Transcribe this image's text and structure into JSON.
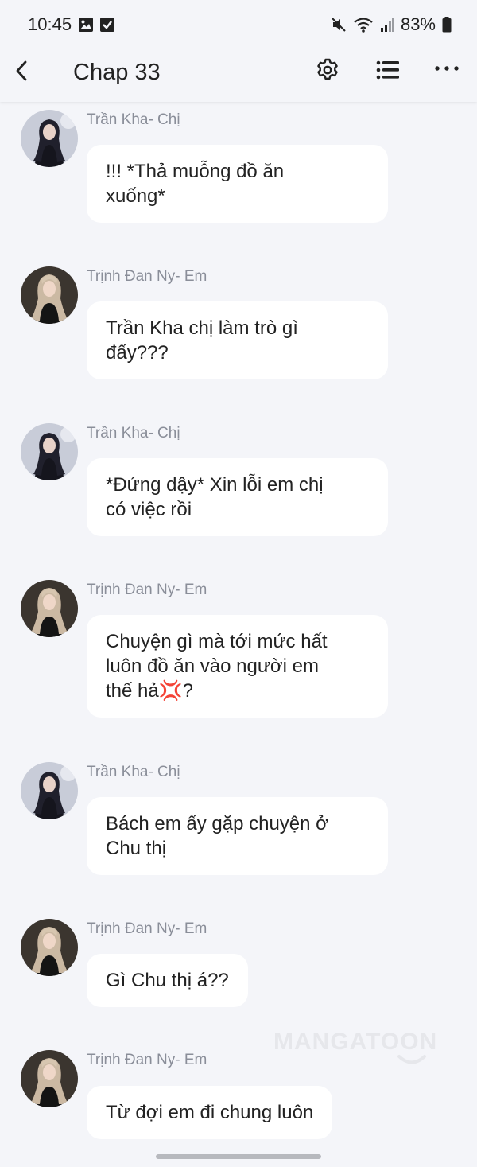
{
  "status_bar": {
    "time": "10:45",
    "battery": "83%",
    "icons": [
      "image-icon",
      "check-box-icon",
      "mute-icon",
      "wifi-icon",
      "signal-icon",
      "battery-icon"
    ]
  },
  "app_bar": {
    "title": "Chap 33",
    "icons": [
      "back-arrow-icon",
      "gear-icon",
      "list-icon",
      "more-icon"
    ]
  },
  "colors": {
    "background": "#f4f5f9",
    "bubble": "#ffffff",
    "sender_name": "#8a8e99",
    "text": "#222222"
  },
  "messages": [
    {
      "sender": "Trần Kha- Chị",
      "avatar": "avatar-dark-hair",
      "text": "!!! *Thả muỗng đồ ăn\nxuống*"
    },
    {
      "sender": "Trịnh Đan Ny- Em",
      "avatar": "avatar-light-hair",
      "text": "Trần Kha chị làm trò gì\nđấy???"
    },
    {
      "sender": "Trần Kha- Chị",
      "avatar": "avatar-dark-hair",
      "text": "*Đứng dậy* Xin lỗi em chị\ncó việc rồi"
    },
    {
      "sender": "Trịnh Đan Ny- Em",
      "avatar": "avatar-light-hair",
      "text": "Chuyện gì mà tới mức hất\nluôn đồ ăn vào người em\nthế hả💢?"
    },
    {
      "sender": "Trần Kha- Chị",
      "avatar": "avatar-dark-hair",
      "text": "Bách em ấy gặp chuyện ở\nChu thị"
    },
    {
      "sender": "Trịnh Đan Ny- Em",
      "avatar": "avatar-light-hair",
      "text": "Gì Chu thị á??"
    },
    {
      "sender": "Trịnh Đan Ny- Em",
      "avatar": "avatar-light-hair",
      "text": "Từ đợi em đi chung luôn"
    }
  ],
  "watermark": "MANGATOON"
}
